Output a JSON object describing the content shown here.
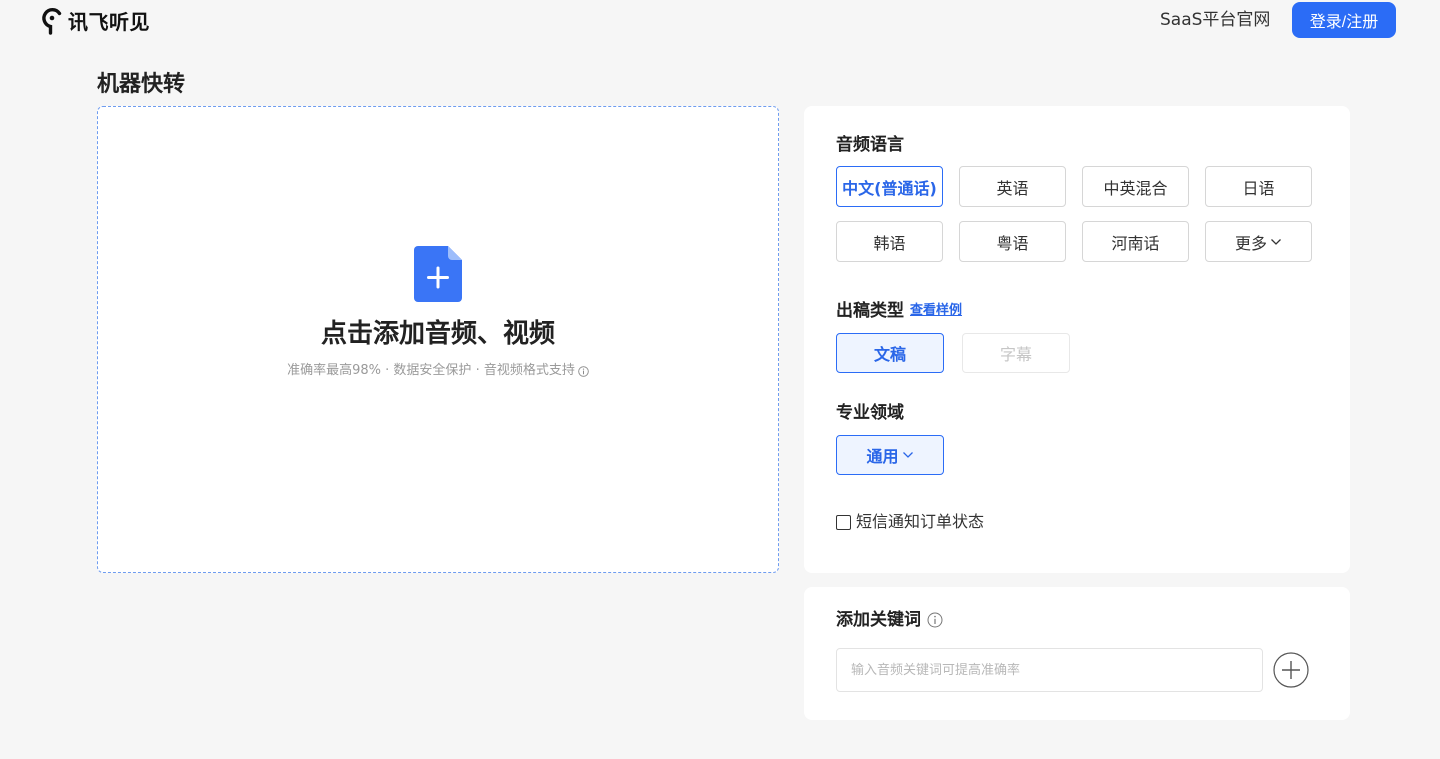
{
  "header": {
    "logo_text": "讯飞听见",
    "saas_link": "SaaS平台官网",
    "login_button": "登录/注册"
  },
  "page_title": "机器快转",
  "upload": {
    "title": "点击添加音频、视频",
    "subtitle": "准确率最高98% · 数据安全保护 · 音视频格式支持"
  },
  "audio_language": {
    "label": "音频语言",
    "options": [
      "中文(普通话)",
      "英语",
      "中英混合",
      "日语",
      "韩语",
      "粤语",
      "河南话",
      "更多"
    ],
    "selected_index": 0
  },
  "output_type": {
    "label": "出稿类型",
    "sample_link": "查看样例",
    "options": [
      "文稿",
      "字幕"
    ],
    "selected_index": 0,
    "disabled_index": 1
  },
  "domain": {
    "label": "专业领域",
    "value": "通用"
  },
  "sms_notify": {
    "label": "短信通知订单状态",
    "checked": false
  },
  "keywords": {
    "label": "添加关键词",
    "placeholder": "输入音频关键词可提高准确率"
  },
  "icons": {
    "logo": "logo-icon",
    "upload": "file-add-icon",
    "info": "info-icon",
    "dropdown": "chevron-down-icon",
    "add_keyword": "plus-circle-icon"
  },
  "colors": {
    "accent": "#2b6cf6",
    "accent_text": "#2a66e8",
    "selected_bg": "#eef4ff",
    "page_bg": "#f6f6f6",
    "disabled_text": "#c6c6c6"
  }
}
